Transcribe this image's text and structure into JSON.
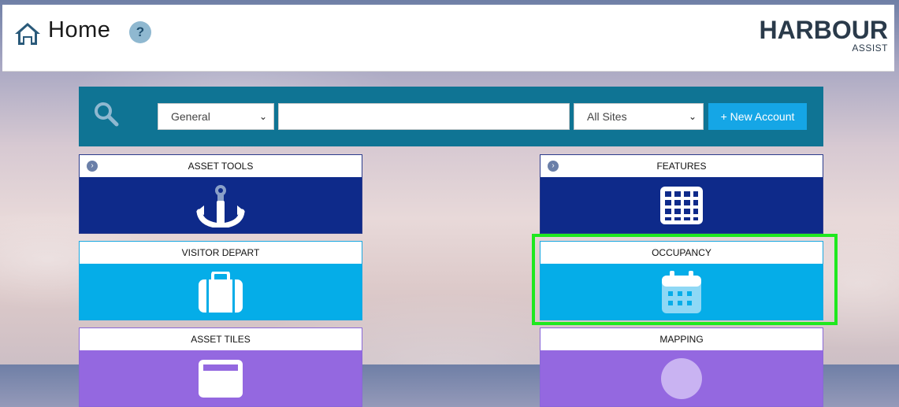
{
  "header": {
    "title": "Home",
    "help_label": "?",
    "logo_main": "HARBOUR",
    "logo_sub": "ASSIST"
  },
  "search": {
    "type_select": "General",
    "input_value": "",
    "site_select": "All Sites",
    "new_account_label": "+ New Account"
  },
  "tiles": [
    {
      "label": "ASSET TOOLS",
      "icon": "anchor-icon",
      "color": "#0e2a8a"
    },
    {
      "label": "FEATURES",
      "icon": "grid-icon",
      "color": "#0e2a8a"
    },
    {
      "label": "VISITOR DEPART",
      "icon": "suitcase-icon",
      "color": "#05ade8"
    },
    {
      "label": "OCCUPANCY",
      "icon": "calendar-icon",
      "color": "#05ade8"
    },
    {
      "label": "ASSET TILES",
      "icon": "tiles-icon",
      "color": "#9468e0"
    },
    {
      "label": "MAPPING",
      "icon": "map-icon",
      "color": "#9468e0"
    }
  ],
  "colors": {
    "highlight": "#1fe81f",
    "search_bar": "#0f7494",
    "button": "#15a6e6"
  }
}
